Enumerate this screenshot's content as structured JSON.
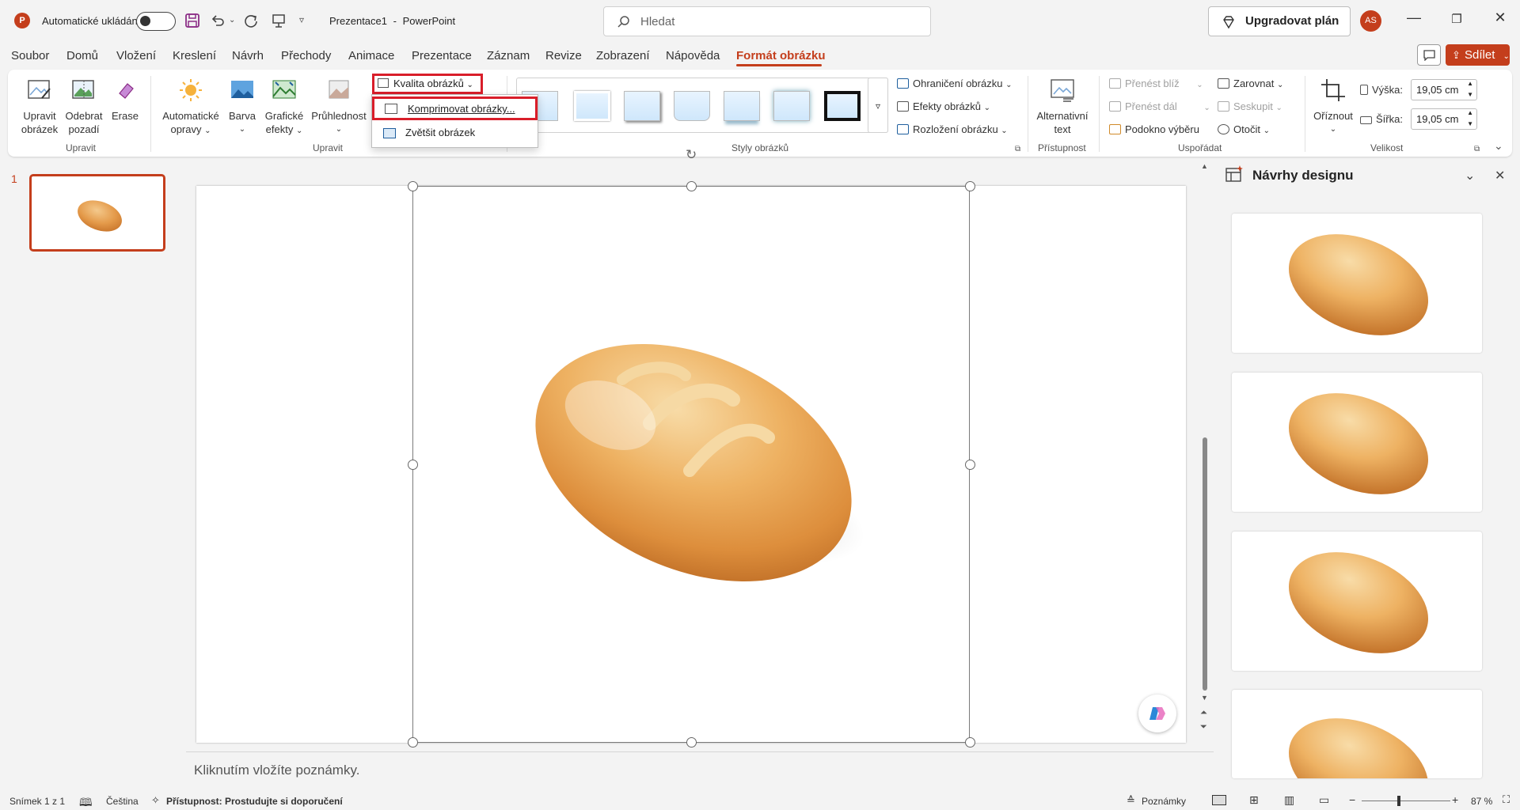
{
  "titlebar": {
    "autosave_label": "Automatické ukládání",
    "doc_title": "Prezentace1",
    "separator": "-",
    "app_name": "PowerPoint",
    "search_placeholder": "Hledat",
    "upgrade_label": "Upgradovat plán",
    "avatar_initials": "AS"
  },
  "tabs": [
    "Soubor",
    "Domů",
    "Vložení",
    "Kreslení",
    "Návrh",
    "Přechody",
    "Animace",
    "Prezentace",
    "Záznam",
    "Revize",
    "Zobrazení",
    "Nápověda",
    "Formát obrázku"
  ],
  "share_label": "Sdílet",
  "ribbon": {
    "upravit_obrazek": [
      "Upravit",
      "obrázek"
    ],
    "odebrat_pozadi": [
      "Odebrat",
      "pozadí"
    ],
    "erase": "Erase",
    "group_upravit_1": "Upravit",
    "auto_opravy": [
      "Automatické",
      "opravy"
    ],
    "barva": "Barva",
    "graficke_efekty": [
      "Grafické",
      "efekty"
    ],
    "pruhlednost": "Průhlednost",
    "group_upravit_2": "Upravit",
    "kvalita": "Kvalita obrázků",
    "styles_group": "Styly obrázků",
    "ohraniceni": "Ohraničení obrázku",
    "efekty": "Efekty obrázků",
    "rozlozeni": "Rozložení obrázku",
    "alt_text": [
      "Alternativní",
      "text"
    ],
    "pristupnost": "Přístupnost",
    "prenest_bliz": "Přenést blíž",
    "prenest_dal": "Přenést dál",
    "podokno": "Podokno výběru",
    "zarovnat": "Zarovnat",
    "seskupit": "Seskupit",
    "otocit": "Otočit",
    "usporadat": "Uspořádat",
    "oriznout": "Oříznout",
    "vyska_label": "Výška:",
    "vyska_value": "19,05 cm",
    "sirka_label": "Šířka:",
    "sirka_value": "19,05 cm",
    "velikost": "Velikost"
  },
  "dropdown": {
    "compress": "Komprimovat obrázky...",
    "enlarge": "Zvětšit obrázek"
  },
  "slide_number": "1",
  "notes_placeholder": "Kliknutím vložíte poznámky.",
  "design_panel": {
    "title": "Návrhy designu"
  },
  "status": {
    "slide": "Snímek 1 z 1",
    "language": "Čeština",
    "accessibility": "Přístupnost: Prostudujte si doporučení",
    "notes": "Poznámky",
    "zoom": "87 %"
  },
  "colors": {
    "accent": "#c43e1c",
    "highlight": "#d91e2a"
  }
}
